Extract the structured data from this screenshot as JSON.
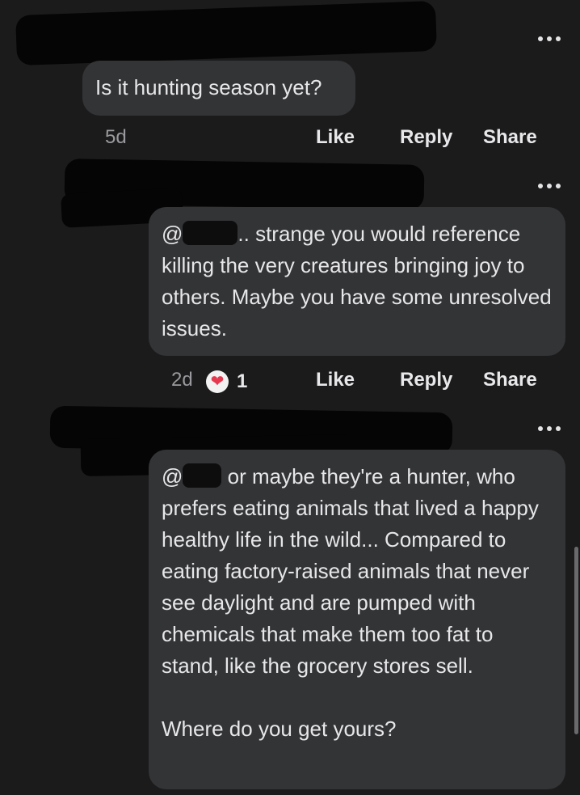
{
  "comments": [
    {
      "text": "Is it hunting season yet?",
      "time": "5d",
      "like": "Like",
      "reply": "Reply",
      "share": "Share"
    },
    {
      "mention_prefix": "@",
      "mention_suffix": "..",
      "text": " strange you would reference killing the very creatures bringing joy to others. Maybe you have some unresolved issues.",
      "time": "2d",
      "reaction_count": "1",
      "like": "Like",
      "reply": "Reply",
      "share": "Share"
    },
    {
      "mention_prefix": "@",
      "text": " or maybe they're a hunter, who prefers eating animals that lived a happy healthy life in the wild... Compared to eating factory-raised animals that never see daylight and are pumped with chemicals that make them too fat to stand, like the grocery stores sell.",
      "text2": "Where do you get yours?"
    }
  ]
}
